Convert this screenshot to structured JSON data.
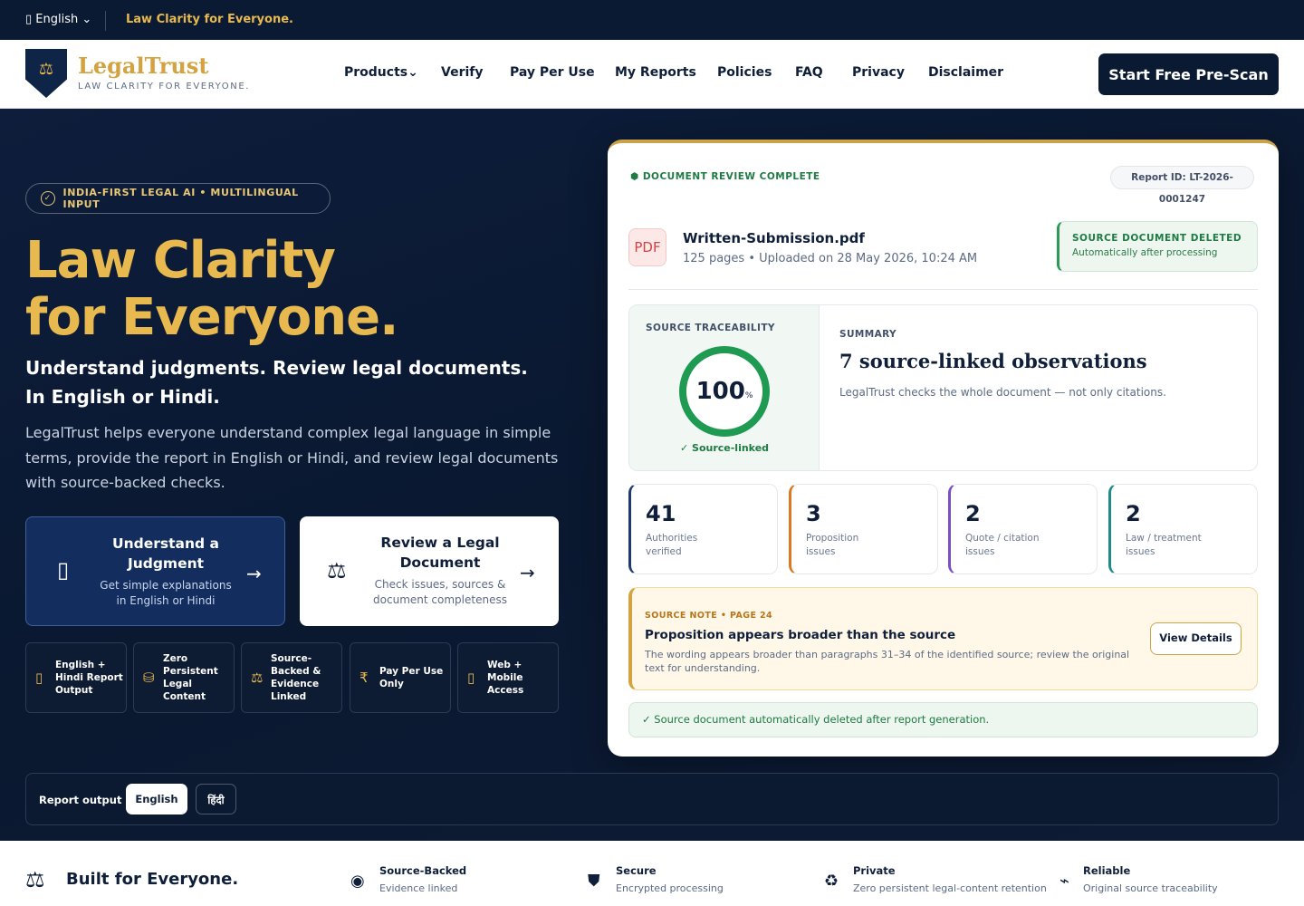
{
  "topbar": {
    "language": "English",
    "tagline": "Law Clarity for Everyone."
  },
  "nav": {
    "brand": "LegalTrust",
    "brand_sub": "LAW CLARITY FOR EVERYONE.",
    "items": [
      "Products",
      "Verify",
      "Pay Per Use",
      "My Reports",
      "Policies",
      "FAQ",
      "Privacy",
      "Disclaimer"
    ],
    "cta": "Start Free Pre-Scan"
  },
  "hero": {
    "pill": "INDIA-FIRST LEGAL AI • MULTILINGUAL INPUT",
    "title_line1": "Law Clarity",
    "title_line2": "for Everyone.",
    "subtitle_line1": "Understand judgments. Review legal documents.",
    "subtitle_line2": "In English or Hindi.",
    "description": "LegalTrust helps everyone understand complex legal language in simple terms, provide the report in English or Hindi, and review legal documents with source-backed checks.",
    "card1": {
      "title": "Understand a Judgment",
      "sub": "Get simple explanations in English or Hindi"
    },
    "card2": {
      "title": "Review a Legal Document",
      "sub": "Check issues, sources & document completeness"
    },
    "features": [
      {
        "icon": "translate-icon",
        "label": "English + Hindi Report Output"
      },
      {
        "icon": "lock-icon",
        "label": "Zero Persistent Legal Content"
      },
      {
        "icon": "scales-icon",
        "label": "Source-Backed & Evidence Linked"
      },
      {
        "icon": "rupee-icon",
        "label": "Pay Per Use Only"
      },
      {
        "icon": "device-icon",
        "label": "Web + Mobile Access"
      }
    ]
  },
  "report": {
    "status": "DOCUMENT REVIEW COMPLETE",
    "report_id": "Report ID: LT-2026-0001247",
    "file_badge": "PDF",
    "file_name": "Written-Submission.pdf",
    "file_meta": "125 pages • Uploaded on 28 May 2026, 10:24 AM",
    "deleted_title": "SOURCE DOCUMENT DELETED",
    "deleted_sub": "Automatically after processing",
    "trace_label": "SOURCE TRACEABILITY",
    "trace_value": "100",
    "trace_unit": "%",
    "trace_fraction": 1.0,
    "trace_caption": "✓ Source-linked",
    "summary_label": "SUMMARY",
    "summary_title": "7 source-linked observations",
    "summary_sub": "LegalTrust checks the whole document — not only citations.",
    "stats": [
      {
        "value": "41",
        "label": "Authorities verified",
        "color": "#1f3a6e"
      },
      {
        "value": "3",
        "label": "Proposition issues",
        "color": "#d97a22"
      },
      {
        "value": "2",
        "label": "Quote / citation issues",
        "color": "#7b4fc4"
      },
      {
        "value": "2",
        "label": "Law / treatment issues",
        "color": "#1f8a8a"
      }
    ],
    "note_kicker": "SOURCE NOTE • PAGE 24",
    "note_title": "Proposition appears broader than the source",
    "note_text": "The wording appears broader than paragraphs 31–34 of the identified source; review the original text for understanding.",
    "note_button": "View Details",
    "footer": "✓ Source document automatically deleted after report generation."
  },
  "output_bar": {
    "label": "Report output",
    "options": [
      "English",
      "हिंदी"
    ],
    "selected": "English"
  },
  "bottom": {
    "title": "Built for Everyone.",
    "items": [
      {
        "icon": "target-icon",
        "title": "Source-Backed",
        "sub": "Evidence linked"
      },
      {
        "icon": "shield-icon",
        "title": "Secure",
        "sub": "Encrypted processing"
      },
      {
        "icon": "recycle-icon",
        "title": "Private",
        "sub": "Zero persistent legal-content retention"
      },
      {
        "icon": "link-icon",
        "title": "Reliable",
        "sub": "Original source traceability"
      }
    ]
  }
}
